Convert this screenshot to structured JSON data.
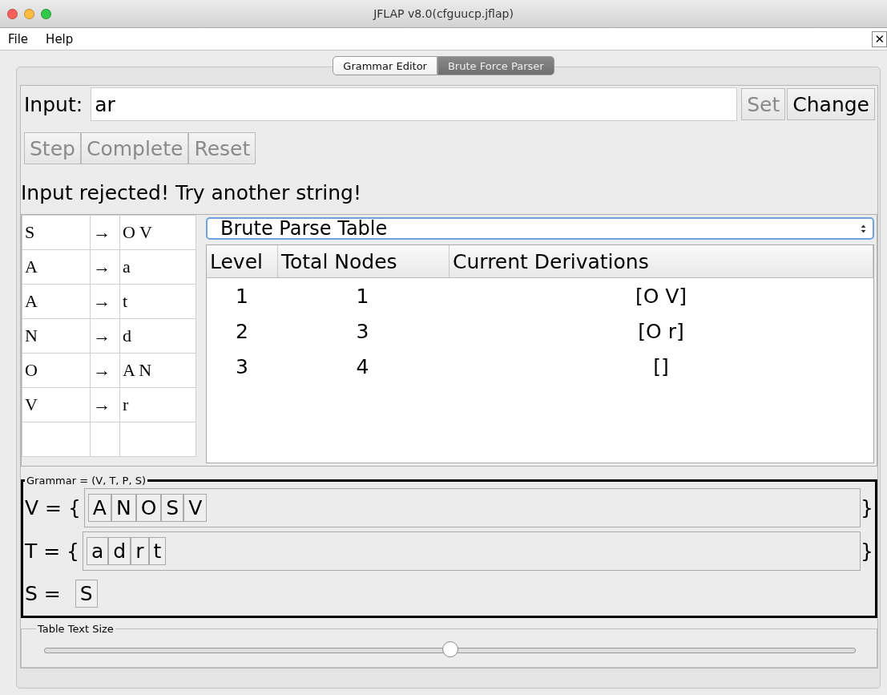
{
  "window": {
    "title": "JFLAP v8.0(cfguucp.jflap)"
  },
  "menu": [
    "File",
    "Help"
  ],
  "menu_close": "✕",
  "tabs": [
    {
      "label": "Grammar Editor",
      "selected": false
    },
    {
      "label": "Brute Force Parser",
      "selected": true
    }
  ],
  "input": {
    "label": "Input:",
    "value": "ar"
  },
  "input_buttons": [
    {
      "label": "Set",
      "disabled": true
    },
    {
      "label": "Change",
      "disabled": false
    }
  ],
  "control_buttons": [
    {
      "label": "Step",
      "disabled": true
    },
    {
      "label": "Complete",
      "disabled": true
    },
    {
      "label": "Reset",
      "disabled": true
    }
  ],
  "message": "Input rejected! Try another string!",
  "productions": [
    {
      "lhs": "S",
      "arrow": "→",
      "rhs": "O V"
    },
    {
      "lhs": "A",
      "arrow": "→",
      "rhs": "a"
    },
    {
      "lhs": "A",
      "arrow": "→",
      "rhs": "t"
    },
    {
      "lhs": "N",
      "arrow": "→",
      "rhs": "d"
    },
    {
      "lhs": "O",
      "arrow": "→",
      "rhs": "A N"
    },
    {
      "lhs": "V",
      "arrow": "→",
      "rhs": "r"
    }
  ],
  "view_select": "Brute Parse Table",
  "parse_table": {
    "columns": [
      "Level",
      "Total Nodes",
      "Current Derivations"
    ],
    "rows": [
      [
        "1",
        "1",
        "[O V]"
      ],
      [
        "2",
        "3",
        "[O r]"
      ],
      [
        "3",
        "4",
        "[]"
      ]
    ]
  },
  "grammar": {
    "title": "Grammar = (V, T, P, S)",
    "sets": [
      {
        "label": "V = {",
        "symbols": [
          "A",
          "N",
          "O",
          "S",
          "V"
        ],
        "close": "}"
      },
      {
        "label": "T = {",
        "symbols": [
          "a",
          "d",
          "r",
          "t"
        ],
        "close": "}"
      }
    ],
    "start": {
      "label": "S =",
      "symbols": [
        "S"
      ]
    }
  },
  "text_size": {
    "title": "Table Text Size",
    "level": 0.5
  }
}
